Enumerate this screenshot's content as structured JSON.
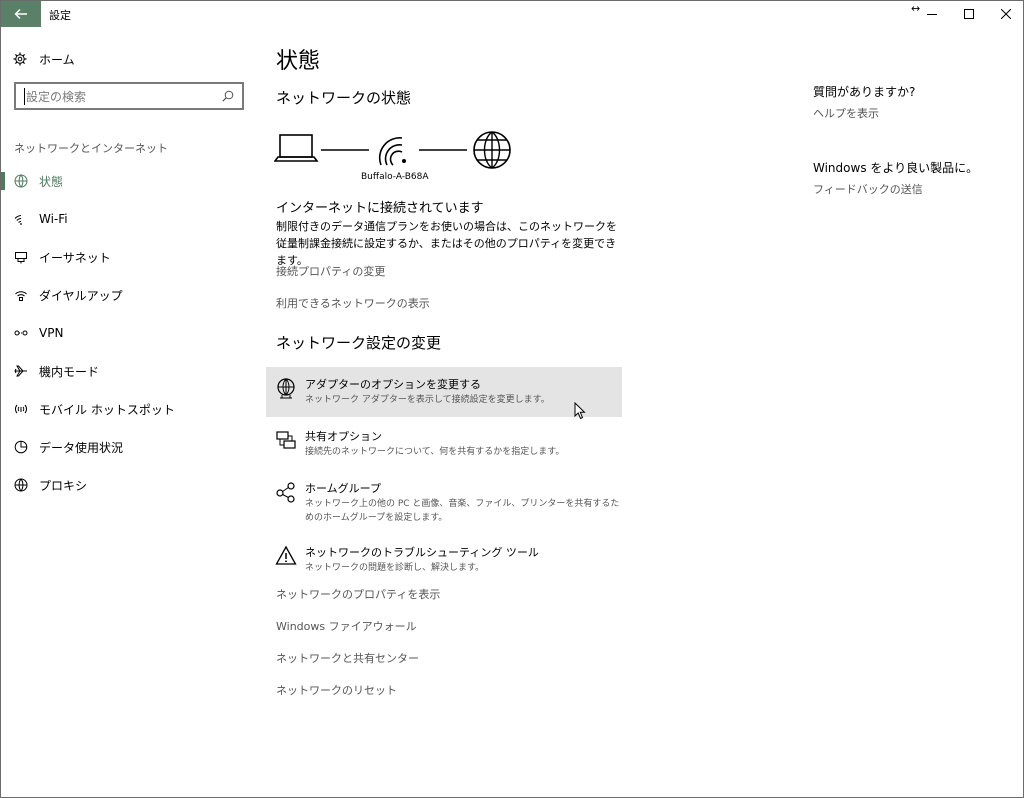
{
  "window": {
    "title": "設定"
  },
  "sidebar": {
    "home_label": "ホーム",
    "search_placeholder": "設定の検索",
    "section_label": "ネットワークとインターネット",
    "items": [
      {
        "label": "状態",
        "icon": "status-icon",
        "active": true
      },
      {
        "label": "Wi-Fi",
        "icon": "wifi-icon"
      },
      {
        "label": "イーサネット",
        "icon": "ethernet-icon"
      },
      {
        "label": "ダイヤルアップ",
        "icon": "dialup-icon"
      },
      {
        "label": "VPN",
        "icon": "vpn-icon"
      },
      {
        "label": "機内モード",
        "icon": "airplane-icon"
      },
      {
        "label": "モバイル ホットスポット",
        "icon": "hotspot-icon"
      },
      {
        "label": "データ使用状況",
        "icon": "data-usage-icon"
      },
      {
        "label": "プロキシ",
        "icon": "globe-icon"
      }
    ]
  },
  "main": {
    "page_title": "状態",
    "network_status_heading": "ネットワークの状態",
    "ssid": "Buffalo-A-B68A",
    "connected_title": "インターネットに接続されています",
    "connected_desc": "制限付きのデータ通信プランをお使いの場合は、このネットワークを従量制課金接続に設定するか、またはその他のプロパティを変更できます。",
    "link_conn_props": "接続プロパティの変更",
    "link_show_networks": "利用できるネットワークの表示",
    "change_settings_heading": "ネットワーク設定の変更",
    "options": [
      {
        "title": "アダプターのオプションを変更する",
        "desc": "ネットワーク アダプターを表示して接続設定を変更します。",
        "icon": "adapter-icon",
        "hover": true
      },
      {
        "title": "共有オプション",
        "desc": "接続先のネットワークについて、何を共有するかを指定します。",
        "icon": "sharing-icon"
      },
      {
        "title": "ホームグループ",
        "desc": "ネットワーク上の他の PC と画像、音楽、ファイル、プリンターを共有するためのホームグループを設定します。",
        "icon": "homegroup-icon"
      },
      {
        "title": "ネットワークのトラブルシューティング ツール",
        "desc": "ネットワークの問題を診断し、解決します。",
        "icon": "warning-icon"
      }
    ],
    "links_bottom": [
      "ネットワークのプロパティを表示",
      "Windows ファイアウォール",
      "ネットワークと共有センター",
      "ネットワークのリセット"
    ]
  },
  "right": {
    "question_title": "質問がありますか?",
    "help_link": "ヘルプを表示",
    "feedback_title": "Windows をより良い製品に。",
    "feedback_link": "フィードバックの送信"
  },
  "colors": {
    "accent": "#4f7a5e",
    "back_button": "#5b8068",
    "hover_bg": "#e4e4e4"
  }
}
